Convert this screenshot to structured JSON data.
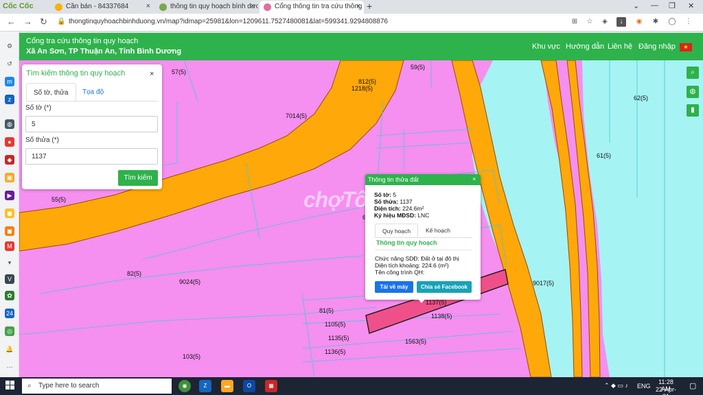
{
  "browser": {
    "brand": "Cốc Cốc",
    "tabs": [
      {
        "title": "Cần bán - 84337684",
        "icon_color": "#f5b400"
      },
      {
        "title": "thông tin quy hoạch bình dươ",
        "icon_color": "#7aa84a"
      },
      {
        "title": "Cổng thông tin tra cứu thông",
        "icon_color": "#e06ea0"
      }
    ],
    "new_tab": "+",
    "url": "thongtinquyhoachbinhduong.vn/map?idmap=25981&lon=1209611.7527480081&lat=599341.9294808876"
  },
  "header": {
    "title": "Cổng tra cứu thông tin quy hoạch",
    "subtitle": "Xã An Sơn, TP Thuận An, Tỉnh Bình Dương",
    "nav": [
      "Khu vực",
      "Hướng dẫn",
      "Liên hệ",
      "Đăng nhập"
    ]
  },
  "search": {
    "title": "Tìm kiếm thông tin quy hoạch",
    "close": "×",
    "tabs": [
      "Số tờ, thửa",
      "Tọa độ"
    ],
    "sheet_label": "Số tờ (*)",
    "sheet_value": "5",
    "parcel_label": "Số thửa (*)",
    "parcel_value": "1137",
    "button": "Tìm kiếm"
  },
  "popup": {
    "title": "Thông tin thửa đất",
    "close": "×",
    "rows": [
      {
        "label": "Số tờ:",
        "value": "5"
      },
      {
        "label": "Số thửa:",
        "value": "1137"
      },
      {
        "label": "Diện tích:",
        "value": "224.6m²"
      },
      {
        "label": "Ký hiệu MĐSD:",
        "value": "LNC"
      }
    ],
    "tabs": [
      "Quy hoạch",
      "Kế hoạch"
    ],
    "section_title": "Thông tin quy hoạch",
    "function": "Chức năng SDĐ: Đất ở tại đô thị",
    "area": "Diện tích khoảng: 224.6 (m²)",
    "project": "Tên công trình QH:",
    "btn_download": "Tải về máy",
    "btn_share": "Chia sẻ Facebook"
  },
  "map": {
    "watermark": "chợTốt",
    "labels": [
      "57(5)",
      "59(5)",
      "812(5)",
      "1218(5)",
      "62(5)",
      "7014(5)",
      "61(5)",
      "55(5)",
      "6",
      "82(5)",
      "9024(5)",
      "9017(5)",
      "1137(5)",
      "1138(5)",
      "81(5)",
      "1105(5)",
      "1135(5)",
      "1563(5)",
      "1136(5)",
      "103(5)"
    ],
    "colors": {
      "residential": "#f58ff0",
      "road": "#fea80a",
      "water": "#a6f3f3",
      "highlight": "#f0508a"
    }
  },
  "taskbar": {
    "search_placeholder": "Type here to search",
    "lang": "ENG",
    "time": "11:28 AM",
    "date": "22-Apr-21"
  }
}
